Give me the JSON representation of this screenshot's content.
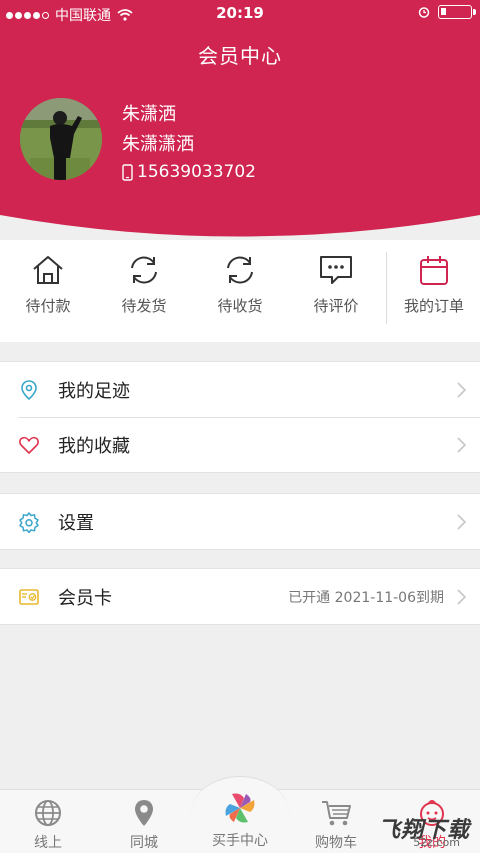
{
  "status_bar": {
    "carrier": "中国联通",
    "time": "20:19"
  },
  "header": {
    "title": "会员中心",
    "bg_color": "#cf2550"
  },
  "user": {
    "name": "朱潇洒",
    "nickname": "朱潇潇洒",
    "phone": "15639033702"
  },
  "orders": [
    {
      "label": "待付款",
      "icon": "house-icon"
    },
    {
      "label": "待发货",
      "icon": "refresh-icon"
    },
    {
      "label": "待收货",
      "icon": "refresh-icon"
    },
    {
      "label": "待评价",
      "icon": "message-icon"
    },
    {
      "label": "我的订单",
      "icon": "calendar-icon"
    }
  ],
  "menu": {
    "footprint": "我的足迹",
    "favorites": "我的收藏",
    "settings": "设置",
    "member_card": "会员卡",
    "member_card_status": "已开通 2021-11-06到期"
  },
  "tabs": [
    {
      "label": "线上",
      "icon": "globe-icon"
    },
    {
      "label": "同城",
      "icon": "location-pin-icon"
    },
    {
      "label": "买手中心",
      "icon": "pinwheel-logo-icon"
    },
    {
      "label": "购物车",
      "icon": "cart-icon"
    },
    {
      "label": "我的",
      "icon": "baby-face-icon"
    }
  ],
  "watermark": {
    "text": "飞翔下载",
    "sub": "52z.com"
  }
}
